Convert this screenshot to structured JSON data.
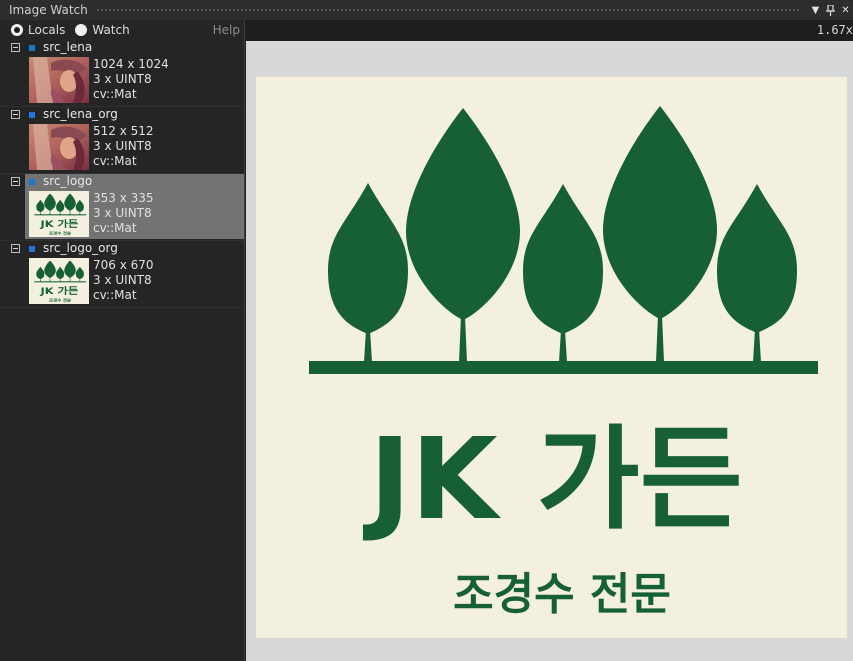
{
  "window": {
    "title": "Image Watch"
  },
  "modes": [
    {
      "label": "Locals",
      "selected": true
    },
    {
      "label": "Watch",
      "selected": false
    }
  ],
  "help_label": "Help",
  "zoom": "1.67x",
  "items": [
    {
      "name": "src_lena",
      "size": "1024 x 1024",
      "channels": "3 x UINT8",
      "type": "cv::Mat",
      "thumb": "lena"
    },
    {
      "name": "src_lena_org",
      "size": "512 x 512",
      "channels": "3 x UINT8",
      "type": "cv::Mat",
      "thumb": "lena"
    },
    {
      "name": "src_logo",
      "size": "353 x 335",
      "channels": "3 x UINT8",
      "type": "cv::Mat",
      "thumb": "logo",
      "selected": true
    },
    {
      "name": "src_logo_org",
      "size": "706 x 670",
      "channels": "3 x UINT8",
      "type": "cv::Mat",
      "thumb": "logo"
    }
  ],
  "viewer": {
    "logo_title": "JK 가든",
    "logo_subtitle": "조경수 전문",
    "logo_green": "#176037",
    "logo_background": "#f3f0df"
  },
  "colors": {
    "selection": "#737373",
    "accent_square": "#1f75d2"
  }
}
